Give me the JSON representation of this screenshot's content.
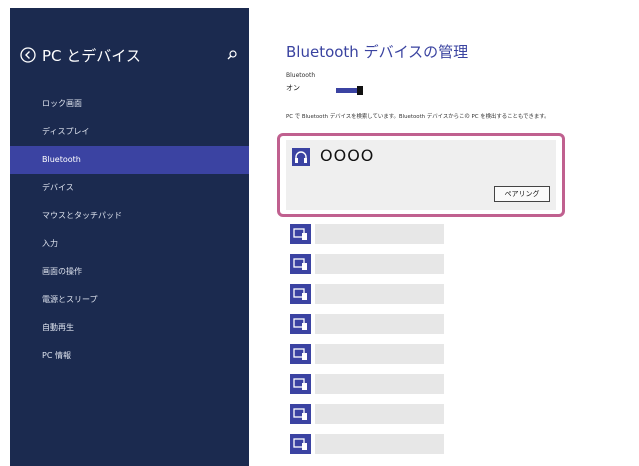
{
  "sidebar": {
    "title": "PC とデバイス",
    "items": [
      {
        "label": "ロック画面"
      },
      {
        "label": "ディスプレイ"
      },
      {
        "label": "Bluetooth",
        "active": true
      },
      {
        "label": "デバイス"
      },
      {
        "label": "マウスとタッチパッド"
      },
      {
        "label": "入力"
      },
      {
        "label": "画面の操作"
      },
      {
        "label": "電源とスリープ"
      },
      {
        "label": "自動再生"
      },
      {
        "label": "PC 情報"
      }
    ]
  },
  "main": {
    "title": "Bluetooth デバイスの管理",
    "bluetooth_label": "Bluetooth",
    "bluetooth_state": "オン",
    "info_text": "PC で Bluetooth デバイスを検索しています。Bluetooth デバイスからこの PC を検出することもできます。",
    "selected_device": {
      "name": "OOOO",
      "pair_label": "ペアリング"
    },
    "device_placeholders": 8
  },
  "colors": {
    "sidebar_bg": "#1b2a4f",
    "accent": "#3b43a2",
    "highlight": "#c0608f"
  },
  "icons": [
    "back-icon",
    "search-icon",
    "headphones-icon",
    "device-icon"
  ]
}
